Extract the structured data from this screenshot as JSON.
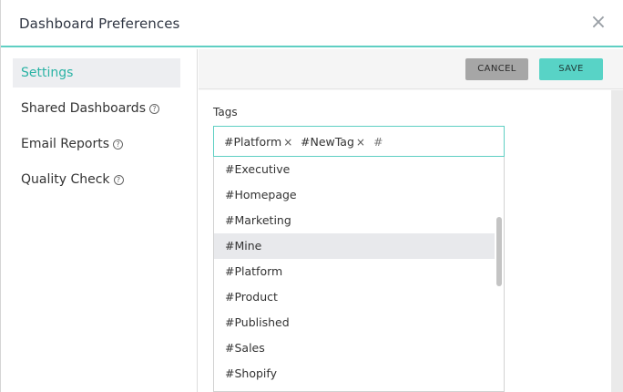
{
  "header": {
    "title": "Dashboard Preferences",
    "close_glyph": "×"
  },
  "sidebar": {
    "items": [
      {
        "label": "Settings",
        "active": true,
        "help": false
      },
      {
        "label": "Shared Dashboards",
        "active": false,
        "help": true
      },
      {
        "label": "Email Reports",
        "active": false,
        "help": true
      },
      {
        "label": "Quality Check",
        "active": false,
        "help": true
      }
    ]
  },
  "toolbar": {
    "cancel_label": "CANCEL",
    "save_label": "SAVE"
  },
  "tags": {
    "label": "Tags",
    "selected": [
      "#Platform",
      "#NewTag"
    ],
    "input_value": "#",
    "options": [
      "#Executive",
      "#Homepage",
      "#Marketing",
      "#Mine",
      "#Platform",
      "#Product",
      "#Published",
      "#Sales",
      "#Shopify"
    ],
    "highlighted_option": "#Mine"
  },
  "colors": {
    "accent": "#5fcfc3",
    "save": "#58d3c6",
    "cancel": "#a6a6a6",
    "active_text": "#2bb3a5"
  },
  "icons": {
    "close": "close-icon",
    "help": "help-circle-icon",
    "chip_remove": "remove-tag-icon"
  }
}
